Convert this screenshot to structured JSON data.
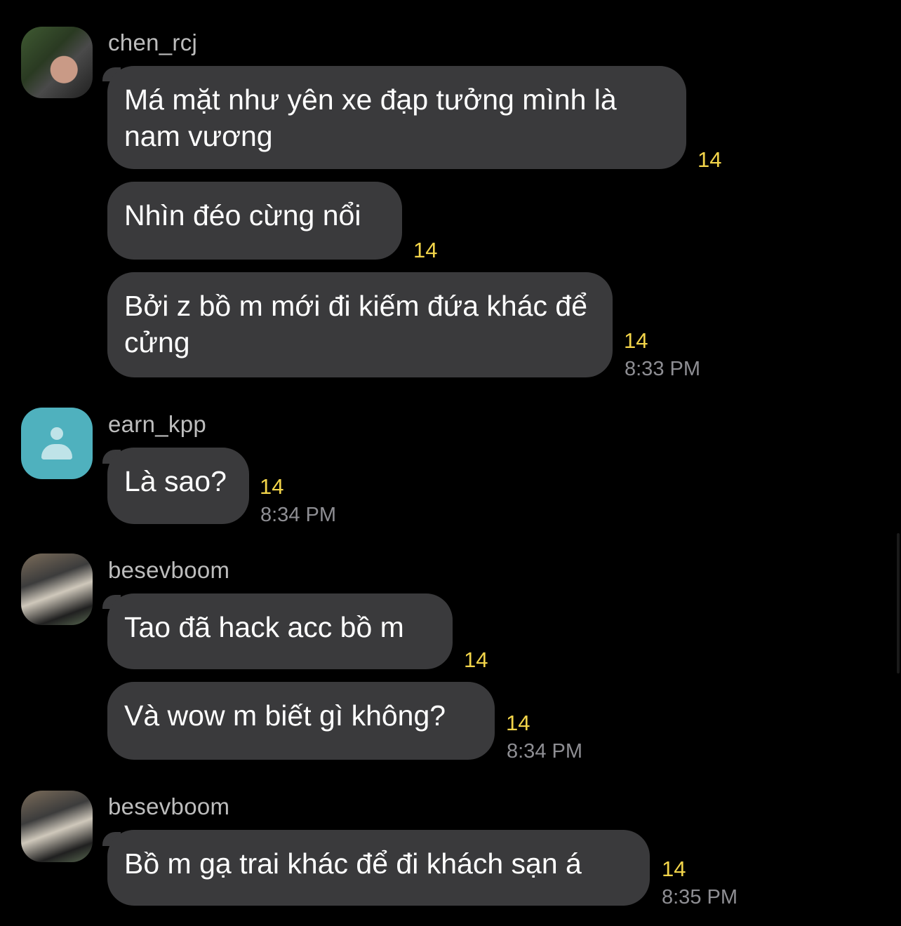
{
  "groups": [
    {
      "sender": "chen_rcj",
      "avatar": "photo-avatar",
      "messages": [
        {
          "text": "Má mặt như yên xe đạp tưởng mình là nam vương",
          "count": "14"
        },
        {
          "text": "Nhìn đéo cừng nổi",
          "count": "14"
        },
        {
          "text": "Bởi z bồ m mới đi kiếm đứa khác để cửng",
          "count": "14",
          "time": "8:33 PM"
        }
      ]
    },
    {
      "sender": "earn_kpp",
      "avatar": "person-placeholder-icon",
      "messages": [
        {
          "text": "Là sao?",
          "count": "14",
          "time": "8:34 PM"
        }
      ]
    },
    {
      "sender": "besevboom",
      "avatar": "photo-avatar",
      "messages": [
        {
          "text": "Tao đã hack acc bồ m",
          "count": "14"
        },
        {
          "text": "Và wow m biết gì không?",
          "count": "14",
          "time": "8:34 PM"
        }
      ]
    },
    {
      "sender": "besevboom",
      "avatar": "photo-avatar",
      "messages": [
        {
          "text": "Bồ m gạ trai khác để đi khách sạn á",
          "count": "14",
          "time": "8:35 PM"
        }
      ]
    }
  ],
  "colors": {
    "background": "#000000",
    "bubble": "#3a3a3c",
    "count": "#f2d44a",
    "time": "#8e8e93",
    "sender": "#bdbdbd",
    "placeholder_avatar": "#4fb1be"
  }
}
